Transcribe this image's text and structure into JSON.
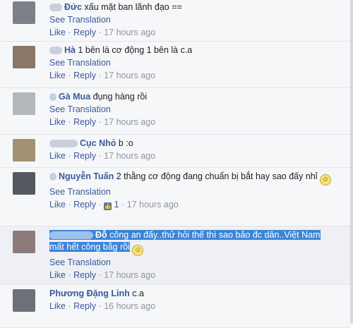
{
  "comments": [
    {
      "name": "Đức",
      "text": "xấu mặt ban lãnh đạo ==",
      "see_translation": "See Translation",
      "like": "Like",
      "reply": "Reply",
      "time": "17 hours ago"
    },
    {
      "name": "Hà",
      "text": "1 bên là cơ động 1 bên là c.a",
      "see_translation": "See Translation",
      "like": "Like",
      "reply": "Reply",
      "time": "17 hours ago"
    },
    {
      "name": "Gà Mua",
      "text": "đụng hàng rồi",
      "see_translation": "See Translation",
      "like": "Like",
      "reply": "Reply",
      "time": "17 hours ago"
    },
    {
      "name": "Cục Nhỏ",
      "text": "b :o",
      "like": "Like",
      "reply": "Reply",
      "time": "17 hours ago"
    },
    {
      "name": "Nguyễn Tuấn",
      "text": "2 thằng cơ động đang chuẩn bị bắt hay sao đấy nhỉ",
      "see_translation": "See Translation",
      "like": "Like",
      "reply": "Reply",
      "like_count": "1",
      "time": "17 hours ago"
    },
    {
      "name": "Đỗ",
      "text": "công an đấy..thử hỏi thế thì sao bảo đc dân..Việt Nam mất hết công bằg rồi",
      "see_translation": "See Translation",
      "like": "Like",
      "reply": "Reply",
      "time": "17 hours ago"
    },
    {
      "name": "Phương Đặng Linh",
      "text": "c.a",
      "like": "Like",
      "reply": "Reply",
      "time": "16 hours ago"
    }
  ],
  "emoticon_icon": "smiley-icon",
  "like_icon": "thumbs-up-icon",
  "colors": {
    "link": "#3b5998",
    "selection": "#3b84d6",
    "timestamp": "#90949c",
    "background": "#f6f7f9"
  }
}
